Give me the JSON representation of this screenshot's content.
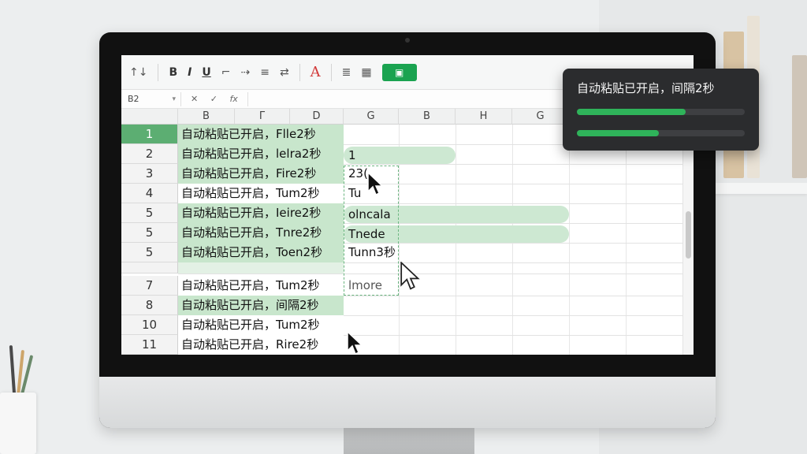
{
  "ribbon": {
    "buttons": [
      {
        "label": "↑↓",
        "icon": "sort-icon"
      },
      {
        "label": "B",
        "icon": "bold-icon"
      },
      {
        "label": "I",
        "icon": "italic-icon"
      },
      {
        "label": "U",
        "icon": "underline-icon"
      },
      {
        "label": "⌐",
        "icon": "fill-color-icon"
      },
      {
        "label": "⇢",
        "icon": "border-icon"
      },
      {
        "label": "≡",
        "icon": "align-icon"
      },
      {
        "label": "⇄",
        "icon": "merge-icon"
      },
      {
        "label": "A",
        "icon": "font-color-icon"
      },
      {
        "label": "≣",
        "icon": "wrap-text-icon"
      },
      {
        "label": "▦",
        "icon": "table-style-icon"
      }
    ],
    "accent": "#1aa350"
  },
  "formula_bar": {
    "name_box": "B2",
    "cancel": "✕",
    "confirm": "✓",
    "fx": "fx"
  },
  "columns": [
    "B",
    "Γ",
    "D",
    "G",
    "B",
    "H",
    "G"
  ],
  "rows": [
    {
      "num": "1",
      "b": "自动粘贴已开启，Flle2秒",
      "g": ""
    },
    {
      "num": "2",
      "b": "自动粘贴已开启，lelra2秒",
      "g": "1"
    },
    {
      "num": "3",
      "b": "自动粘贴已开启，Fire2秒",
      "g": "23("
    },
    {
      "num": "4",
      "b": "自动粘贴已开启，Tum2秒",
      "g": "Tu"
    },
    {
      "num": "5",
      "b": "自动粘贴已开启，Ieire2秒",
      "g": "olncala"
    },
    {
      "num": "5",
      "b": "自动粘贴已开启，Tnre2秒",
      "g": "Tnede"
    },
    {
      "num": "5",
      "b": "自动粘贴已开启，Toen2秒",
      "g": "Tunn3秒"
    },
    {
      "num": "7",
      "b": "自动粘贴已开启，Tum2秒",
      "g": "lmore"
    },
    {
      "num": "8",
      "b": "自动粘贴已开启，间隔2秒",
      "g": ""
    },
    {
      "num": "10",
      "b": "自动粘贴已开启，Tum2秒",
      "g": ""
    },
    {
      "num": "11",
      "b": "自动粘贴已开启，Rire2秒",
      "g": ""
    }
  ],
  "toast": {
    "message": "自动粘贴已开启，间隔2秒",
    "progress": [
      0.65,
      0.49
    ],
    "bar_color": "#2fb35a"
  }
}
